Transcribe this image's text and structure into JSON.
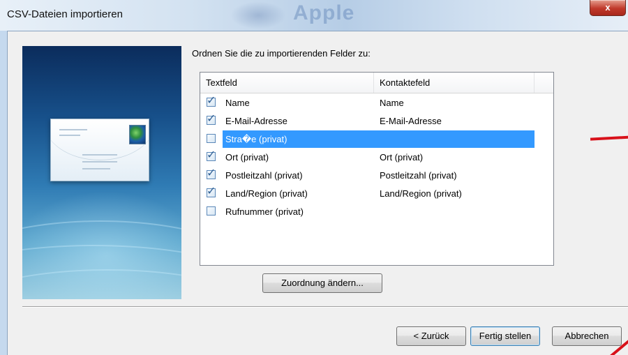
{
  "window": {
    "title": "CSV-Dateien importieren",
    "background_title": "Apple",
    "close_label": "x"
  },
  "prompt": "Ordnen Sie die zu importierenden Felder zu:",
  "listview": {
    "columns": [
      "Textfeld",
      "Kontaktefeld"
    ],
    "rows": [
      {
        "field": "Name",
        "mapped": "Name",
        "checked": true,
        "selected": false
      },
      {
        "field": "E-Mail-Adresse",
        "mapped": "E-Mail-Adresse",
        "checked": true,
        "selected": false
      },
      {
        "field": "Stra�e (privat)",
        "mapped": "",
        "checked": false,
        "selected": true
      },
      {
        "field": "Ort (privat)",
        "mapped": "Ort (privat)",
        "checked": true,
        "selected": false
      },
      {
        "field": "Postleitzahl (privat)",
        "mapped": "Postleitzahl (privat)",
        "checked": true,
        "selected": false
      },
      {
        "field": "Land/Region (privat)",
        "mapped": "Land/Region (privat)",
        "checked": true,
        "selected": false
      },
      {
        "field": "Rufnummer (privat)",
        "mapped": "",
        "checked": false,
        "selected": false
      }
    ]
  },
  "buttons": {
    "change_mapping": "Zuordnung ändern...",
    "back": "< Zurück",
    "finish": "Fertig stellen",
    "cancel": "Abbrechen"
  },
  "icons": {
    "close": "close-icon",
    "checkbox_checked": "check-icon",
    "illustration": "envelope-globe-icon"
  },
  "colors": {
    "selection": "#3399ff",
    "close_button": "#c0392b",
    "annotation": "#d8111a"
  }
}
